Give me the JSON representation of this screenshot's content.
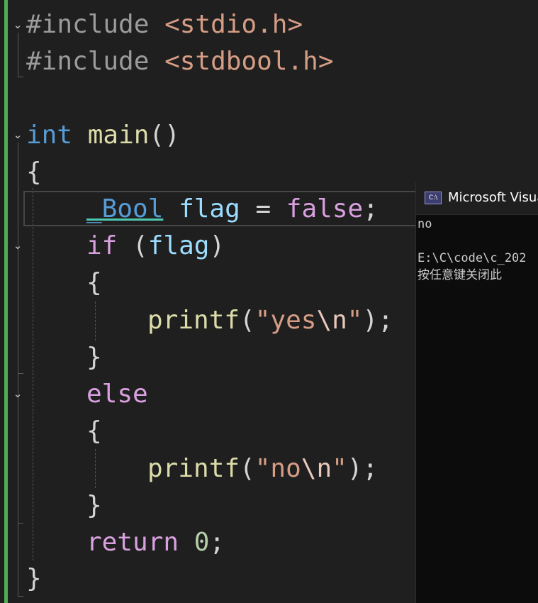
{
  "editor": {
    "lines": {
      "l1": {
        "a": "#include",
        "b": " ",
        "c": "<stdio.h>"
      },
      "l2": {
        "a": "#include",
        "b": " ",
        "c": "<stdbool.h>"
      },
      "l4": {
        "a": "int",
        "b": " ",
        "c": "main",
        "d": "()"
      },
      "l5": {
        "a": "{"
      },
      "l6": {
        "type": "_Bool",
        "sp1": " ",
        "var": "flag",
        "eq": " = ",
        "val": "false",
        "semi": ";"
      },
      "l7": {
        "kw": "if",
        "sp": " ",
        "open": "(",
        "var": "flag",
        "close": ")"
      },
      "l8": {
        "a": "{"
      },
      "l9": {
        "fn": "printf",
        "open": "(",
        "q1": "\"yes",
        "esc": "\\n",
        "q2": "\"",
        "close": ");"
      },
      "l10": {
        "a": "}"
      },
      "l11": {
        "kw": "else"
      },
      "l12": {
        "a": "{"
      },
      "l13": {
        "fn": "printf",
        "open": "(",
        "q1": "\"no",
        "esc": "\\n",
        "q2": "\"",
        "close": ");"
      },
      "l14": {
        "a": "}"
      },
      "l15": {
        "kw": "return",
        "sp": " ",
        "num": "0",
        "semi": ";"
      },
      "l16": {
        "a": "}"
      }
    },
    "fold_glyph": "⌄",
    "accent_color": "#4caf50"
  },
  "console": {
    "title": "Microsoft Visual",
    "icon_label": "C:\\",
    "output": "no\n\nE:\\C\\code\\c_202\n按任意键关闭此"
  }
}
